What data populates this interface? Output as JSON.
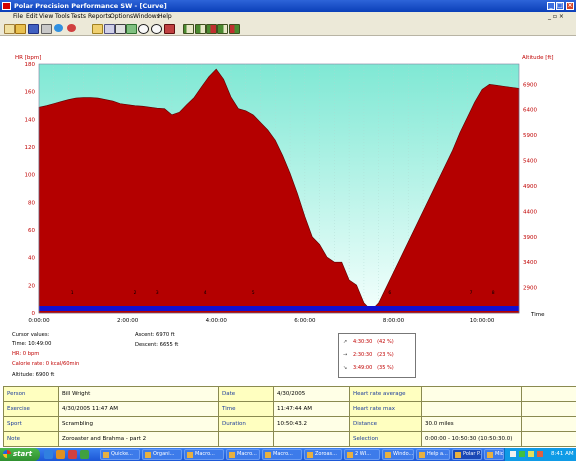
{
  "window": {
    "title": "Polar Precision Performance SW - [Curve]",
    "minimize_icon": "minimize-icon",
    "maximize_icon": "maximize-icon",
    "close_icon": "close-icon"
  },
  "menu": {
    "items": [
      "File",
      "Edit",
      "View",
      "Tools",
      "Tests",
      "Reports",
      "Options",
      "Windows",
      "Help"
    ],
    "mdi_controls": "_ ▫ ×"
  },
  "toolbar": {
    "icons": [
      "new-icon",
      "open-icon",
      "save-icon",
      "print-icon",
      "exercise-icon",
      "person-icon",
      "folder-icon",
      "copy-icon",
      "calendar-icon",
      "weekly-icon",
      "zoom-icon",
      "search-icon",
      "analysis-icon",
      "bar-chart-icon",
      "bar-chart-2-icon",
      "bar-chart-3-icon",
      "bar-chart-4-icon",
      "bar-chart-5-icon"
    ]
  },
  "chart_data": {
    "type": "area",
    "left_axis_label": "HR [bpm]",
    "right_axis_label": "Altitude [ft]",
    "x_axis_label": "Time",
    "left_ticks": [
      "180",
      "160",
      "140",
      "120",
      "100",
      "80",
      "60",
      "40",
      "20",
      "0"
    ],
    "right_ticks": [
      "6900",
      "6400",
      "5900",
      "5400",
      "4900",
      "4400",
      "3900",
      "3400",
      "2900"
    ],
    "x_ticks": [
      "0:00:00",
      "2:00:00",
      "4:00:00",
      "6:00:00",
      "8:00:00",
      "10:00:00"
    ],
    "x_range_min": [
      0,
      650
    ],
    "hr_range": [
      0,
      180
    ],
    "altitude_range": [
      2400,
      7300
    ],
    "altitude_series": {
      "name": "Altitude",
      "x_min": [
        0,
        10,
        20,
        30,
        40,
        50,
        60,
        70,
        80,
        90,
        100,
        110,
        120,
        130,
        140,
        150,
        160,
        170,
        180,
        190,
        200,
        210,
        220,
        230,
        240,
        250,
        260,
        270,
        280,
        290,
        300,
        310,
        320,
        330,
        340,
        350,
        360,
        370,
        380,
        390,
        400,
        410,
        420,
        430,
        440,
        450,
        460,
        470,
        480,
        490,
        500,
        510,
        520,
        530,
        540,
        550,
        560,
        570,
        580,
        590,
        600,
        610,
        620,
        630,
        640,
        650
      ],
      "ft": [
        6450,
        6480,
        6520,
        6560,
        6600,
        6630,
        6640,
        6640,
        6630,
        6600,
        6570,
        6520,
        6500,
        6480,
        6470,
        6450,
        6430,
        6420,
        6300,
        6350,
        6500,
        6640,
        6850,
        7050,
        7200,
        7000,
        6650,
        6420,
        6380,
        6300,
        6150,
        6000,
        5800,
        5500,
        5150,
        4750,
        4300,
        3900,
        3750,
        3500,
        3400,
        3400,
        3050,
        2950,
        2600,
        2450,
        2600,
        2900,
        3200,
        3500,
        3800,
        4100,
        4400,
        4700,
        5000,
        5300,
        5600,
        5950,
        6250,
        6550,
        6800,
        6900,
        6880,
        6860,
        6840,
        6820
      ]
    },
    "markers": [
      "1",
      "2",
      "3",
      "4",
      "5",
      "6",
      "7",
      "8"
    ]
  },
  "info": {
    "cursor_values": "Cursor values:",
    "time": "Time: 10:49:00",
    "hr": "HR: 0 bpm",
    "calorie_rate": "Calorie rate: 0 kcal/60min",
    "altitude": "Altitude: 6900 ft",
    "ascent": "Ascent: 6970 ft",
    "descent": "Descent: 6655 ft"
  },
  "zones": [
    {
      "icon": "ascend-icon",
      "arrow": "↗",
      "time": "4:30:30",
      "pct": "(42 %)"
    },
    {
      "icon": "flat-icon",
      "arrow": "→",
      "time": "2:30:30",
      "pct": "(23 %)"
    },
    {
      "icon": "descend-icon",
      "arrow": "↘",
      "time": "3:49:00",
      "pct": "(35 %)"
    }
  ],
  "table": {
    "rows": [
      [
        {
          "l": "Person"
        },
        {
          "v": "Bill Wright"
        },
        {
          "l": "Date"
        },
        {
          "v": "4/30/2005"
        },
        {
          "l": "Heart rate average"
        },
        {
          "v": ""
        },
        {
          "v": ""
        }
      ],
      [
        {
          "l": "Exercise"
        },
        {
          "v": "4/30/2005 11:47 AM"
        },
        {
          "l": "Time"
        },
        {
          "v": "11:47:44 AM"
        },
        {
          "l": "Heart rate max"
        },
        {
          "v": ""
        },
        {
          "v": ""
        }
      ],
      [
        {
          "l": "Sport"
        },
        {
          "v": "Scrambling"
        },
        {
          "l": "Duration"
        },
        {
          "v": "10:50:43.2"
        },
        {
          "l": "Distance"
        },
        {
          "v": "30.0 miles"
        },
        {
          "v": ""
        }
      ],
      [
        {
          "l": "Note"
        },
        {
          "v": "Zoroaster and Brahma - part 2"
        },
        {
          "v": ""
        },
        {
          "v": ""
        },
        {
          "l": "Selection"
        },
        {
          "v": "0:00:00 - 10:50:30 (10:50:30.0)"
        },
        {
          "v": ""
        }
      ]
    ]
  },
  "taskbar": {
    "start": "start",
    "tasks": [
      "Quicke...",
      "Organi...",
      "Macro...",
      "Macro...",
      "Macro...",
      "Zoroas...",
      "2 WI...",
      "Windo...",
      "Help a...",
      "Polar P...",
      "Mic..."
    ],
    "clock": "8:41 AM"
  },
  "colors": {
    "hr_fill": "#b40000",
    "sky_top": "#7fe8d4",
    "sky_bottom": "#f4fffd",
    "speed_bar": "#1010d0"
  }
}
